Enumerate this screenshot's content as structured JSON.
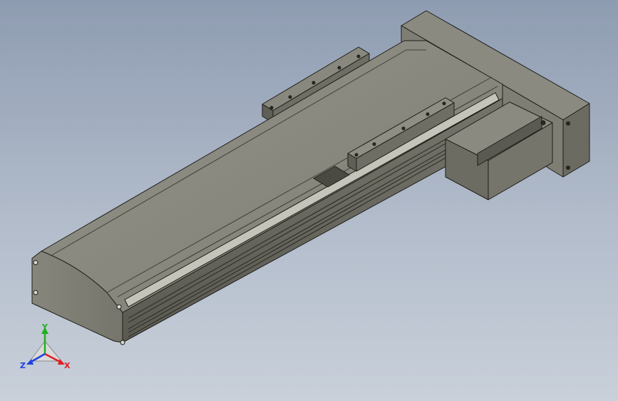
{
  "colors": {
    "background_top": "#8e9cb1",
    "background_bottom": "#c9d0da",
    "body_top": "#8b8b80",
    "body_side": "#6f6f66",
    "body_dark": "#55554e",
    "edge": "#1e1e1a",
    "axis_x": "#e02020",
    "axis_y": "#20b020",
    "axis_z": "#2040e0"
  },
  "triad": {
    "x_label": "X",
    "y_label": "Y",
    "z_label": "Z"
  }
}
